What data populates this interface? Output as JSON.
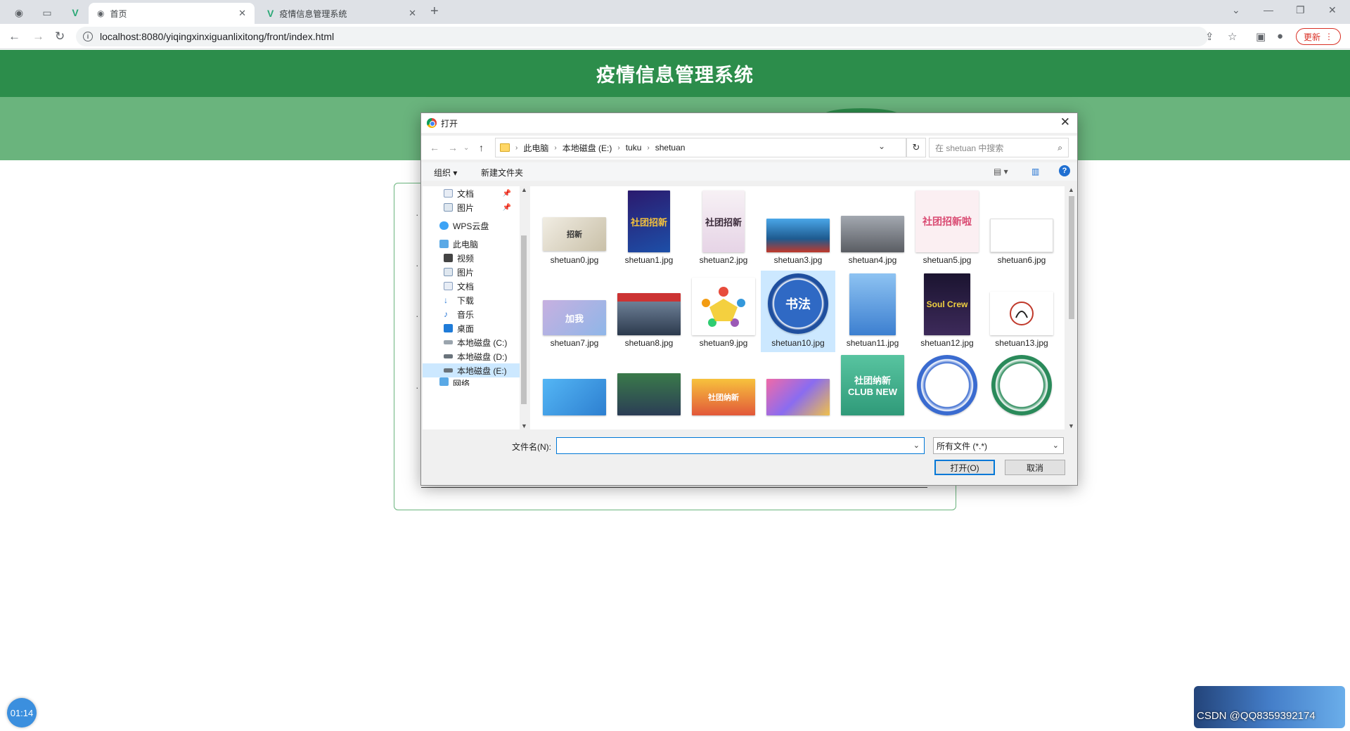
{
  "browser": {
    "tabs": [
      {
        "label": "首页"
      },
      {
        "label": "疫情信息管理系统"
      }
    ],
    "url": "localhost:8080/yiqingxinxiguanlixitong/front/index.html",
    "update_label": "更新"
  },
  "page": {
    "title": "疫情信息管理系统"
  },
  "dialog": {
    "title": "打开",
    "path": [
      "此电脑",
      "本地磁盘 (E:)",
      "tuku",
      "shetuan"
    ],
    "search_placeholder": "在 shetuan 中搜索",
    "toolbar": {
      "organize": "组织 ▾",
      "new_folder": "新建文件夹"
    },
    "sidebar": [
      {
        "label": "文档",
        "pinned": true
      },
      {
        "label": "图片",
        "pinned": true
      },
      {
        "label": "WPS云盘"
      },
      {
        "label": "此电脑"
      },
      {
        "label": "视频"
      },
      {
        "label": "图片"
      },
      {
        "label": "文档"
      },
      {
        "label": "下载"
      },
      {
        "label": "音乐"
      },
      {
        "label": "桌面"
      },
      {
        "label": "本地磁盘 (C:)"
      },
      {
        "label": "本地磁盘 (D:)"
      },
      {
        "label": "本地磁盘 (E:)",
        "selected": true
      },
      {
        "label": "网络"
      }
    ],
    "files": [
      {
        "name": "shetuan0.jpg",
        "art": "招新"
      },
      {
        "name": "shetuan1.jpg",
        "art": "社团招新"
      },
      {
        "name": "shetuan2.jpg",
        "art": "社团招新"
      },
      {
        "name": "shetuan3.jpg",
        "art": ""
      },
      {
        "name": "shetuan4.jpg",
        "art": ""
      },
      {
        "name": "shetuan5.jpg",
        "art": "社团招新啦"
      },
      {
        "name": "shetuan6.jpg",
        "art": ""
      },
      {
        "name": "shetuan7.jpg",
        "art": "加我"
      },
      {
        "name": "shetuan8.jpg",
        "art": ""
      },
      {
        "name": "shetuan9.jpg",
        "art": ""
      },
      {
        "name": "shetuan10.jpg",
        "art": "书法",
        "selected": true
      },
      {
        "name": "shetuan11.jpg",
        "art": ""
      },
      {
        "name": "shetuan12.jpg",
        "art": "Soul Crew"
      },
      {
        "name": "shetuan13.jpg",
        "art": ""
      },
      {
        "name": "",
        "art": ""
      },
      {
        "name": "",
        "art": ""
      },
      {
        "name": "",
        "art": "社团纳新"
      },
      {
        "name": "",
        "art": ""
      },
      {
        "name": "",
        "art": "社团纳新 CLUB NEW"
      },
      {
        "name": "",
        "art": ""
      },
      {
        "name": "",
        "art": ""
      }
    ],
    "filename_label": "文件名(N):",
    "filename_value": "",
    "filter_value": "所有文件 (*.*)",
    "open_label": "打开(O)",
    "cancel_label": "取消"
  },
  "overlay": {
    "timer": "01:14",
    "watermark": "CSDN @QQ8359392174"
  },
  "colors": {
    "header_green": "#2c8d4b",
    "nav_green": "#6ab47d",
    "accent_blue": "#0078d7"
  }
}
